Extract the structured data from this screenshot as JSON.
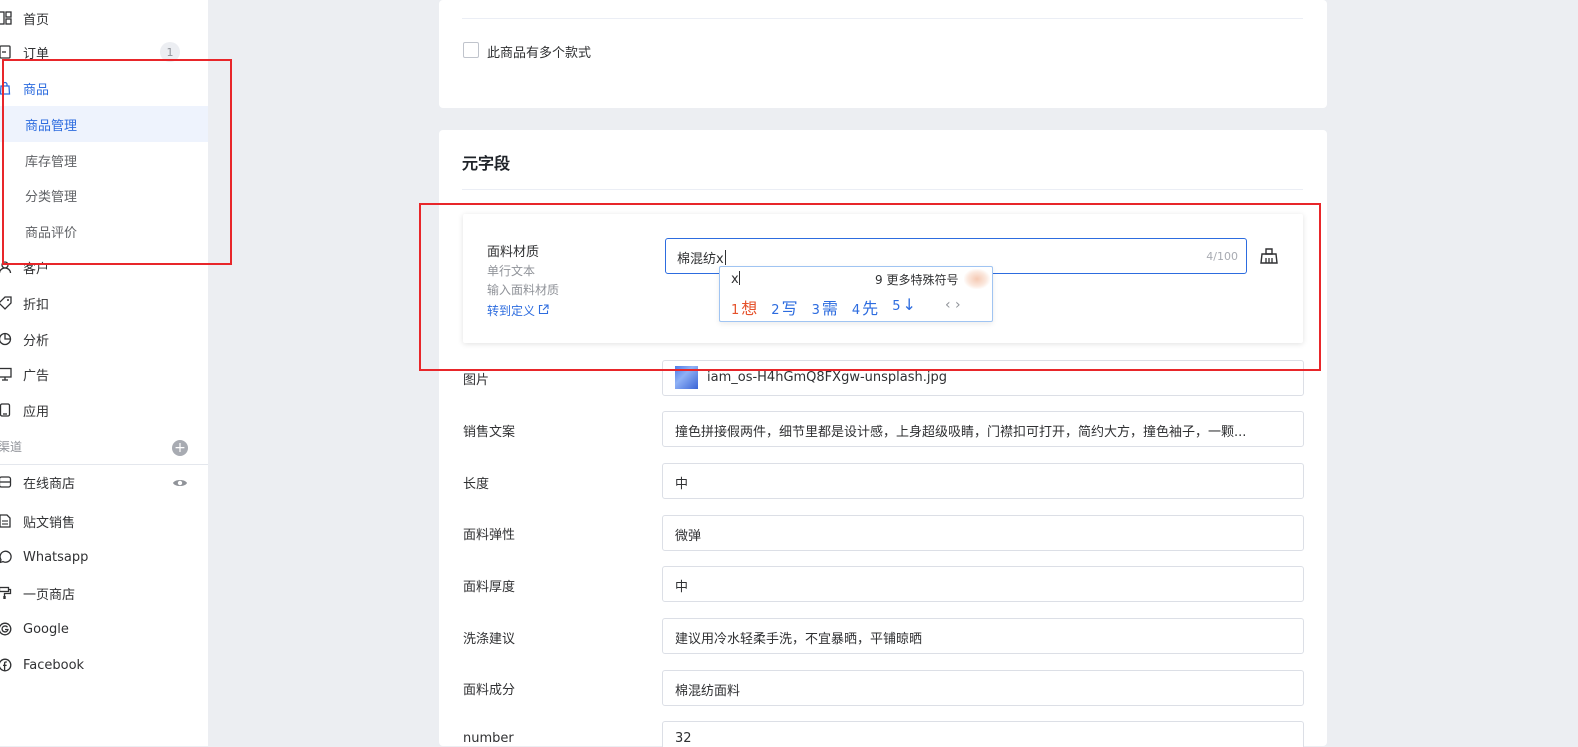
{
  "sidebar": {
    "items": [
      {
        "label": "首页",
        "icon": "dashboard-icon"
      },
      {
        "label": "订单",
        "icon": "order-icon",
        "badge": "1"
      },
      {
        "label": "商品",
        "icon": "bag-icon"
      },
      {
        "label": "客户",
        "icon": "user-icon"
      },
      {
        "label": "折扣",
        "icon": "tag-icon"
      },
      {
        "label": "分析",
        "icon": "pie-icon"
      },
      {
        "label": "广告",
        "icon": "monitor-icon"
      },
      {
        "label": "应用",
        "icon": "app-icon"
      }
    ],
    "sub_items": [
      "商品管理",
      "库存管理",
      "分类管理",
      "商品评价"
    ],
    "channels_label": "渠道",
    "channels": [
      {
        "label": "在线商店",
        "icon": "store-icon"
      },
      {
        "label": "贴文销售",
        "icon": "post-icon"
      },
      {
        "label": "Whatsapp",
        "icon": "whatsapp-icon"
      },
      {
        "label": "一页商店",
        "icon": "paint-icon"
      },
      {
        "label": "Google",
        "icon": "google-icon"
      },
      {
        "label": "Facebook",
        "icon": "facebook-icon"
      }
    ]
  },
  "variants": {
    "checkbox_label": "此商品有多个款式"
  },
  "meta": {
    "title": "元字段",
    "active_field": {
      "name": "面料材质",
      "type": "单行文本",
      "hint": "输入面料材质",
      "link": "转到定义",
      "value": "棉混纺x",
      "count": "4/100"
    },
    "ime": {
      "typed": "x",
      "more": "9 更多特殊符号",
      "candidates": [
        {
          "n": "1",
          "w": "想"
        },
        {
          "n": "2",
          "w": "写"
        },
        {
          "n": "3",
          "w": "需"
        },
        {
          "n": "4",
          "w": "先"
        },
        {
          "n": "5",
          "w": "↓"
        }
      ],
      "pager": "‹ ›"
    },
    "rows": [
      {
        "label": "图片",
        "value": "iam_os-H4hGmQ8FXgw-unsplash.jpg"
      },
      {
        "label": "销售文案",
        "value": "撞色拼接假两件，细节里都是设计感，上身超级吸睛，门襟扣可打开，简约大方，撞色袖子，一颗..."
      },
      {
        "label": "长度",
        "value": "中"
      },
      {
        "label": "面料弹性",
        "value": "微弹"
      },
      {
        "label": "面料厚度",
        "value": "中"
      },
      {
        "label": "洗涤建议",
        "value": "建议用冷水轻柔手洗，不宜暴晒，平铺晾晒"
      },
      {
        "label": "面料成分",
        "value": "棉混纺面料"
      },
      {
        "label": "number",
        "value": "32"
      }
    ]
  },
  "colors": {
    "accent": "#2d6cdf",
    "annotation": "#e8262a"
  }
}
